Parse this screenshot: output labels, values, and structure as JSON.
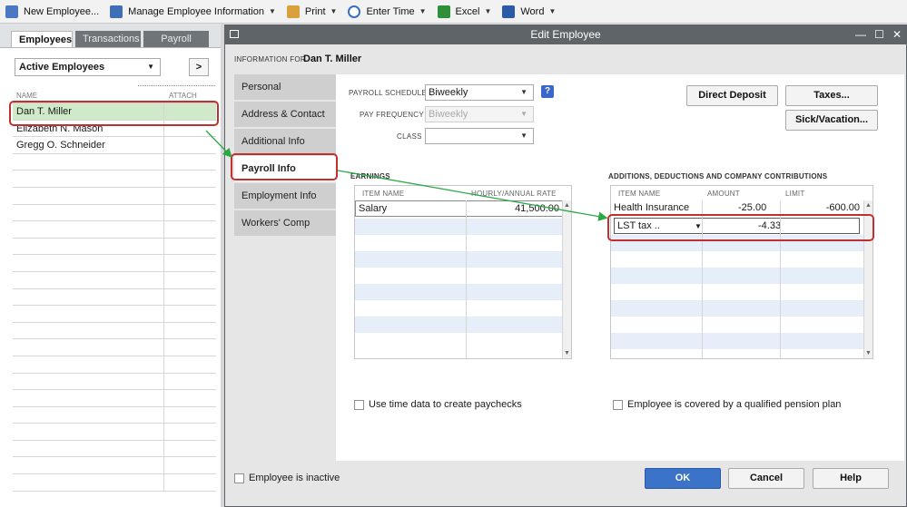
{
  "toolbar": {
    "items": [
      {
        "label": "New Employee...",
        "icon": "new-employee-icon",
        "caret": false
      },
      {
        "label": "Manage Employee Information",
        "icon": "manage-employee-icon",
        "caret": true
      },
      {
        "label": "Print",
        "icon": "print-icon",
        "caret": true
      },
      {
        "label": "Enter Time",
        "icon": "enter-time-icon",
        "caret": true
      },
      {
        "label": "Excel",
        "icon": "excel-icon",
        "caret": true
      },
      {
        "label": "Word",
        "icon": "word-icon",
        "caret": true
      }
    ],
    "caret": "▼"
  },
  "left_panel": {
    "tabs": [
      "Employees",
      "Transactions",
      "Payroll"
    ],
    "filter_value": "Active Employees",
    "nav_button": ">",
    "columns": {
      "name": "NAME",
      "attach": "ATTACH"
    },
    "employees": [
      "Dan T. Miller",
      "Elizabeth N. Mason",
      "Gregg O. Schneider"
    ]
  },
  "dialog": {
    "title": "Edit Employee",
    "info_label": "INFORMATION FOR",
    "employee_name": "Dan T. Miller",
    "window_controls": [
      "—",
      "☐",
      "✕"
    ],
    "side_tabs": [
      "Personal",
      "Address & Contact",
      "Additional Info",
      "Payroll Info",
      "Employment Info",
      "Workers' Comp"
    ],
    "payroll": {
      "schedule_label": "PAYROLL SCHEDULE",
      "schedule_value": "Biweekly",
      "frequency_label": "PAY FREQUENCY",
      "frequency_value": "Biweekly",
      "class_label": "CLASS",
      "class_value": ""
    },
    "buttons": {
      "direct_deposit": "Direct Deposit",
      "taxes": "Taxes...",
      "sick_vacation": "Sick/Vacation...",
      "ok": "OK",
      "cancel": "Cancel",
      "help": "Help"
    },
    "earnings": {
      "title": "EARNINGS",
      "col_item": "ITEM NAME",
      "col_rate": "HOURLY/ANNUAL RATE",
      "rows": [
        {
          "item": "Salary",
          "rate": "41,500.00"
        }
      ]
    },
    "additions": {
      "title": "ADDITIONS, DEDUCTIONS AND COMPANY CONTRIBUTIONS",
      "col_item": "ITEM NAME",
      "col_amount": "AMOUNT",
      "col_limit": "LIMIT",
      "rows": [
        {
          "item": "Health Insurance",
          "amount": "-25.00",
          "limit": "-600.00"
        },
        {
          "item": "LST tax ..",
          "amount": "-4.33",
          "limit": ""
        }
      ]
    },
    "use_time_data_label": "Use time data to create paychecks",
    "pension_label": "Employee is covered by a qualified pension plan",
    "inactive_label": "Employee is inactive"
  },
  "colors": {
    "accent": "#3b73c9",
    "callout": "#c03030",
    "arrow": "#2aa845",
    "selected_row": "#cfe9c9"
  }
}
